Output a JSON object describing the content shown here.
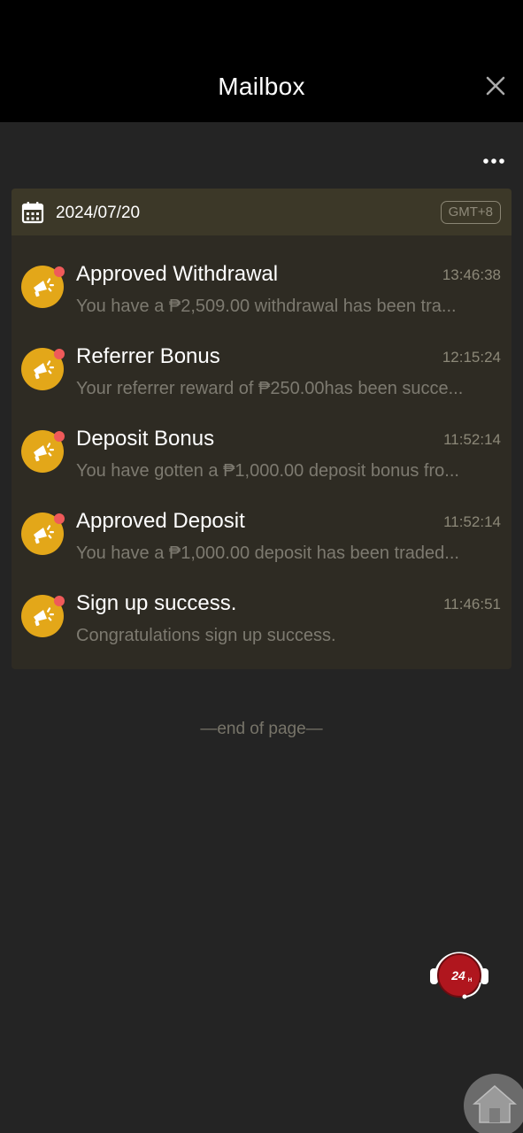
{
  "header": {
    "title": "Mailbox"
  },
  "card": {
    "date": "2024/07/20",
    "timezone": "GMT+8"
  },
  "messages": [
    {
      "title": "Approved Withdrawal",
      "time": "13:46:38",
      "preview": "You have a ₱2,509.00 withdrawal has been tra..."
    },
    {
      "title": "Referrer Bonus",
      "time": "12:15:24",
      "preview": "Your referrer reward of ₱250.00has been succe..."
    },
    {
      "title": "Deposit Bonus",
      "time": "11:52:14",
      "preview": "You have gotten a ₱1,000.00 deposit bonus fro..."
    },
    {
      "title": "Approved Deposit",
      "time": "11:52:14",
      "preview": "You have a ₱1,000.00 deposit has been traded..."
    },
    {
      "title": "Sign up success.",
      "time": "11:46:51",
      "preview": "Congratulations sign up success."
    }
  ],
  "footer": {
    "end_text": "—end of page—"
  },
  "support": {
    "label": "24",
    "suffix": "H"
  },
  "colors": {
    "accent": "#e3a719",
    "unread": "#ef5a5a",
    "card": "#2e2b23",
    "card_header": "#3c3828"
  },
  "icons": {
    "close": "close-icon",
    "more": "more-icon",
    "calendar": "calendar-icon",
    "message": "megaphone-icon",
    "support": "support-24h-icon",
    "home": "home-icon"
  }
}
